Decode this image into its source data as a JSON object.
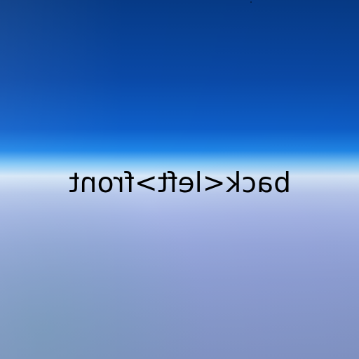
{
  "scene": {
    "label": "back<left>front"
  },
  "colors": {
    "sky_top": "#063a86",
    "sky_mid": "#0e5fc9",
    "horizon_glow": "#d8e8f8",
    "lower_haze": "#97a8dc",
    "text": "#000000"
  }
}
